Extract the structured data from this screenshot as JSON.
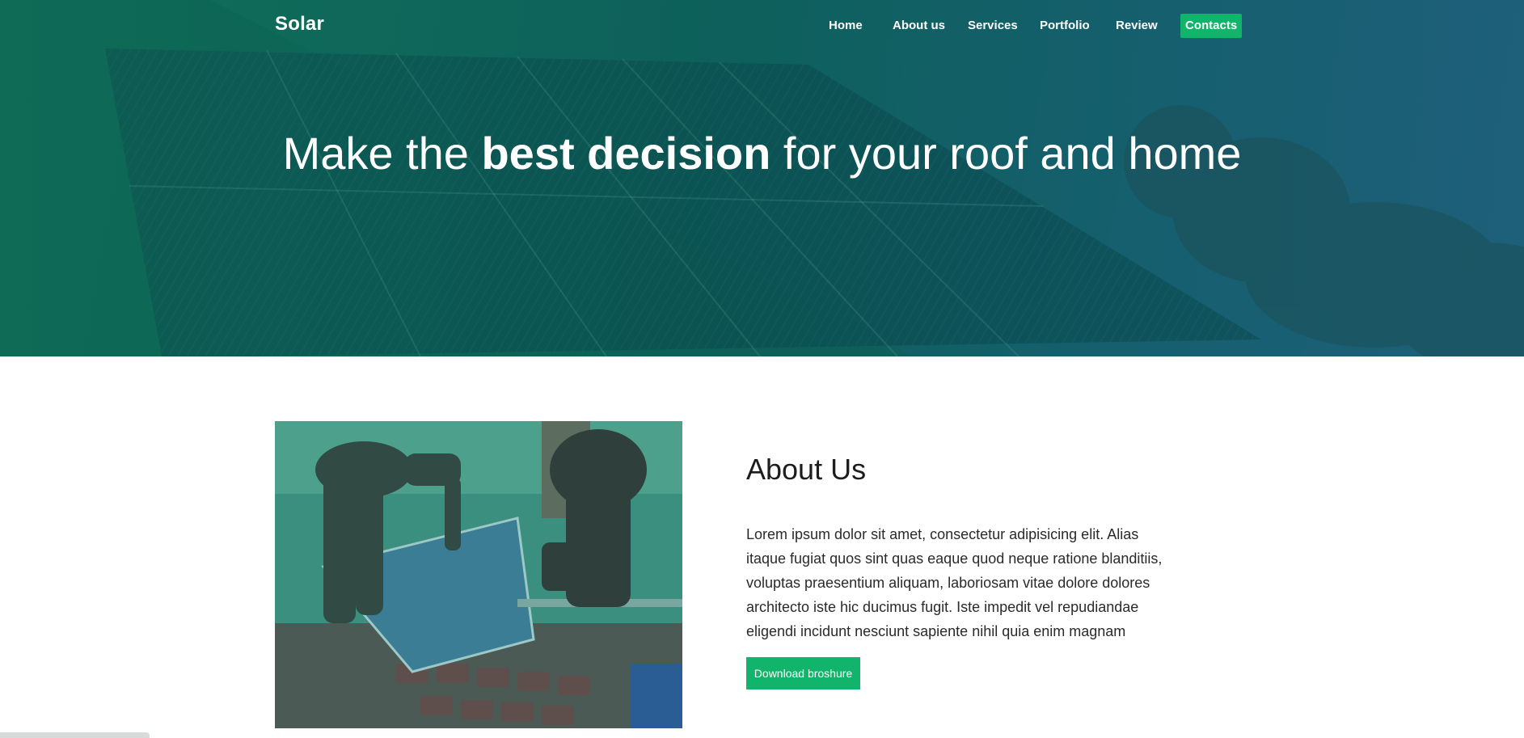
{
  "brand": {
    "name": "Solar"
  },
  "nav": {
    "items": [
      {
        "label": "Home"
      },
      {
        "label": "About us"
      },
      {
        "label": "Services"
      },
      {
        "label": "Portfolio"
      },
      {
        "label": "Review"
      },
      {
        "label": "Contacts"
      }
    ],
    "active_index": 5
  },
  "hero": {
    "title_pre": "Make the ",
    "title_bold": "best decision",
    "title_post": " for your roof and home"
  },
  "about": {
    "title": "About Us",
    "text": "Lorem ipsum dolor sit amet, consectetur adipisicing elit. Alias itaque fugiat quos sint quas eaque quod neque ratione blanditiis, voluptas praesentium aliquam, laboriosam vitae dolore dolores architecto iste hic ducimus fugit. Iste impedit vel repudiandae eligendi incidunt nesciunt sapiente nihil quia enim magnam",
    "button_label": "Download broshure"
  },
  "colors": {
    "accent": "#10b46a",
    "hero_overlay": "#0d5e5a",
    "text": "#2a2a2a"
  }
}
